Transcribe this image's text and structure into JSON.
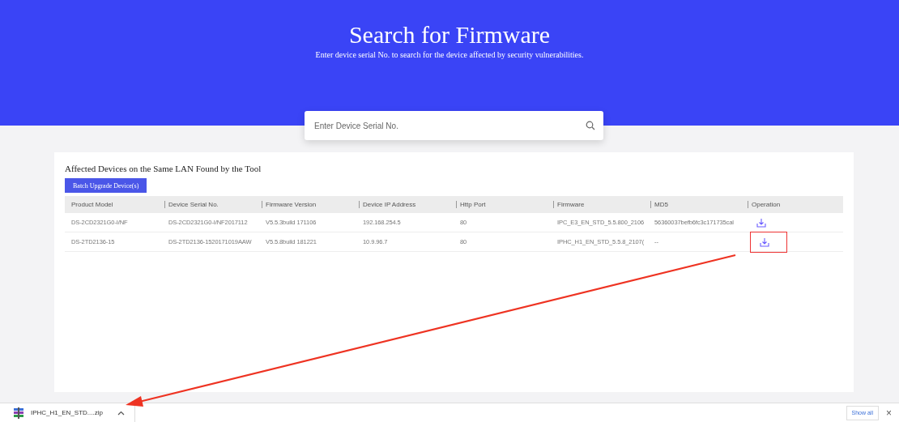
{
  "header": {
    "title": "Search for Firmware",
    "subtitle": "Enter device serial No. to search for the device affected by security vulnerabilities."
  },
  "search": {
    "placeholder": "Enter Device Serial No."
  },
  "panel": {
    "title": "Affected Devices on the Same LAN Found by the Tool",
    "button": "Batch Upgrade Device(s)"
  },
  "table": {
    "columns": [
      "Product Model",
      "Device Serial No.",
      "Firmware Version",
      "Device IP Address",
      "Http Port",
      "Firmware",
      "MD5",
      "Operation"
    ],
    "rows": [
      {
        "cells": [
          "DS-2CD2321G0-I/NF",
          "DS-2CD2321G0-I/NF2017112",
          "V5.5.3build 171106",
          "192.168.254.5",
          "80",
          "IPC_E3_EN_STD_5.5.800_2106",
          "56360037befb6fc3c171735cal"
        ],
        "highlighted": false
      },
      {
        "cells": [
          "DS-2TD2136-15",
          "DS-2TD2136-1520171019AAW",
          "V5.5.8build 181221",
          "10.9.96.7",
          "80",
          "IPHC_H1_EN_STD_5.5.8_2107(",
          "--"
        ],
        "highlighted": true
      }
    ]
  },
  "downloads": {
    "file": "IPHC_H1_EN_STD....zip",
    "show_all": "Show all",
    "close": "×"
  }
}
